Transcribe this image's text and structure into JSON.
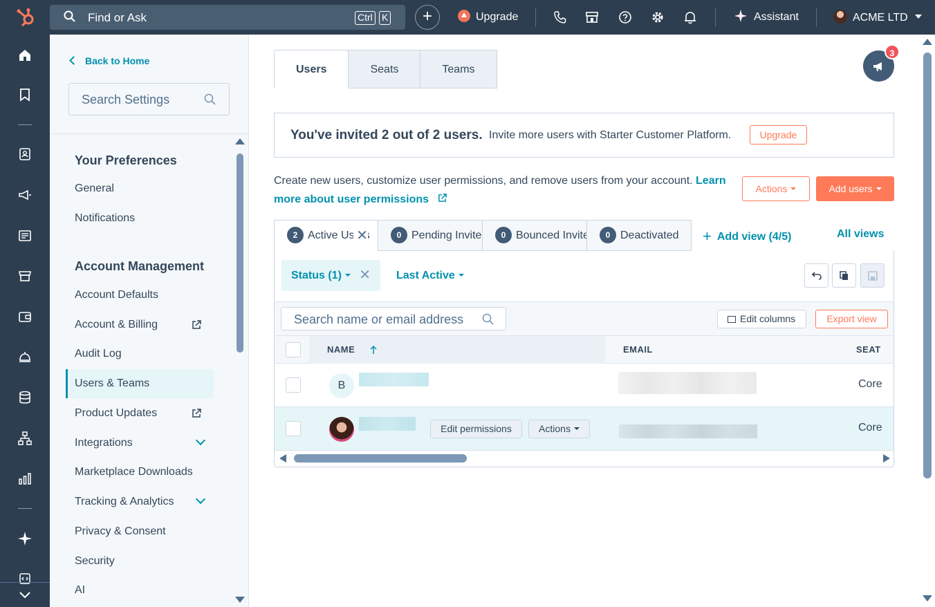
{
  "topbar": {
    "search_placeholder": "Find or Ask",
    "kbd_ctrl": "Ctrl",
    "kbd_k": "K",
    "upgrade": "Upgrade",
    "assistant": "Assistant",
    "account": "ACME LTD"
  },
  "settings": {
    "back": "Back to Home",
    "search_placeholder": "Search Settings",
    "groups": {
      "preferences": "Your Preferences",
      "account_management": "Account Management"
    },
    "items": {
      "general": "General",
      "notifications": "Notifications",
      "account_defaults": "Account Defaults",
      "account_billing": "Account & Billing",
      "audit_log": "Audit Log",
      "users_teams": "Users & Teams",
      "product_updates": "Product Updates",
      "integrations": "Integrations",
      "marketplace_downloads": "Marketplace Downloads",
      "tracking_analytics": "Tracking & Analytics",
      "privacy_consent": "Privacy & Consent",
      "security": "Security",
      "ai": "AI"
    }
  },
  "main": {
    "tabs": [
      "Users",
      "Seats",
      "Teams"
    ],
    "notification_count": "3",
    "banner": {
      "title": "You've invited 2 out of 2 users.",
      "subtitle": "Invite more users with Starter Customer Platform.",
      "upgrade": "Upgrade"
    },
    "description": "Create new users, customize user permissions, and remove users from your account.",
    "learn_more": "Learn more about user permissions",
    "actions_button": "Actions",
    "add_users_button": "Add users",
    "views": [
      {
        "count": "2",
        "label": "Active Users"
      },
      {
        "count": "0",
        "label": "Pending Invites"
      },
      {
        "count": "0",
        "label": "Bounced Invites"
      },
      {
        "count": "0",
        "label": "Deactivated"
      }
    ],
    "add_view": "Add view (4/5)",
    "all_views": "All views",
    "filters": {
      "status": "Status (1)",
      "last_active": "Last Active"
    },
    "table": {
      "search_placeholder": "Search name or email address",
      "edit_columns": "Edit columns",
      "export_view": "Export view",
      "columns": [
        "NAME",
        "EMAIL",
        "SEAT"
      ],
      "rows": [
        {
          "initial": "B",
          "seat": "Core"
        },
        {
          "initial": "",
          "seat": "Core",
          "edit_permissions": "Edit permissions",
          "actions": "Actions"
        }
      ]
    }
  },
  "colors": {
    "nav_bg": "#2d3e50",
    "accent_teal": "#0091ae",
    "accent_orange": "#ff7a59",
    "badge_red": "#f2545b"
  }
}
